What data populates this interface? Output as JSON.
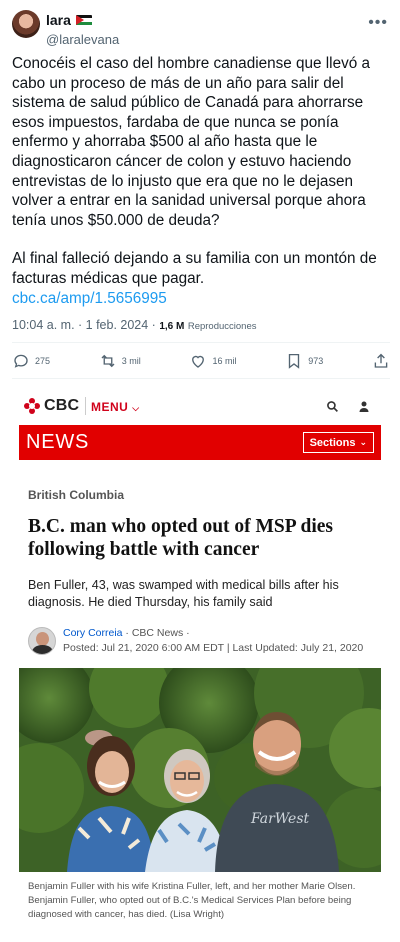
{
  "tweet": {
    "author": {
      "name": "lara",
      "handle": "@laralevana"
    },
    "paragraphs": [
      "Conocéis el caso del hombre canadiense que llevó a cabo un proceso de más de un año para salir del sistema de salud público de Canadá para ahorrarse esos impuestos, fardaba de que nunca se ponía enfermo y ahorraba $500 al año hasta que le diagnosticaron cáncer de colon y estuvo haciendo entrevistas de lo injusto que era que no le dejasen volver a entrar en la sanidad universal porque ahora tenía unos $50.000 de deuda?",
      "Al final falleció dejando a su familia con un montón de facturas médicas que pagar."
    ],
    "link": "cbc.ca/amp/1.5656995",
    "timestamp": "10:04 a. m. · 1 feb. 2024 ·",
    "views_count": "1,6 M",
    "views_label": "Reproducciones",
    "actions": {
      "replies": "275",
      "reposts": "3 mil",
      "likes": "16 mil",
      "bookmarks": "973"
    }
  },
  "article": {
    "logo_text": "CBC",
    "menu_label": "MENU",
    "section_title": "NEWS",
    "sections_label": "Sections",
    "category": "British Columbia",
    "headline": "B.C. man who opted out of MSP dies following battle with cancer",
    "deck": "Ben Fuller, 43, was swamped with medical bills after his diagnosis. He died Thursday, his family said",
    "author": "Cory Correia",
    "outlet": " · CBC News ·",
    "dates": "Posted: Jul 21, 2020 6:00 AM EDT | Last Updated: July 21, 2020",
    "caption": "Benjamin Fuller with his wife Kristina Fuller, left, and her mother Marie Olsen. Benjamin Fuller, who opted out of B.C.'s Medical Services Plan before being diagnosed with cancer, has died. (Lisa Wright)",
    "shirt_text": "FarWest",
    "colors": {
      "cbc_red": "#e10000",
      "link_blue": "#1d9bf0"
    }
  }
}
